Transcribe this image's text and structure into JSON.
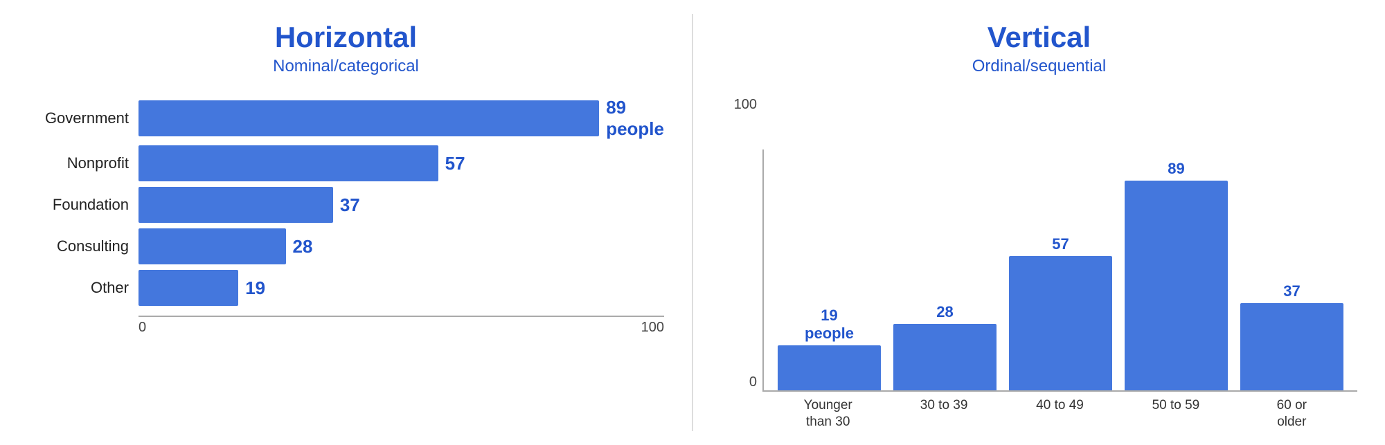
{
  "horizontal": {
    "title": "Horizontal",
    "subtitle": "Nominal/categorical",
    "bars": [
      {
        "label": "Government",
        "value": 89,
        "display": "89 people",
        "pct": 89
      },
      {
        "label": "Nonprofit",
        "value": 57,
        "display": "57",
        "pct": 57
      },
      {
        "label": "Foundation",
        "value": 37,
        "display": "37",
        "pct": 37
      },
      {
        "label": "Consulting",
        "value": 28,
        "display": "28",
        "pct": 28
      },
      {
        "label": "Other",
        "value": 19,
        "display": "19",
        "pct": 19
      }
    ],
    "axis": {
      "min": "0",
      "max": "100"
    }
  },
  "vertical": {
    "title": "Vertical",
    "subtitle": "Ordinal/sequential",
    "bars": [
      {
        "label": "Younger\nthan 30",
        "value": 19,
        "display": "19\npeople",
        "pct": 19
      },
      {
        "label": "30 to 39",
        "value": 28,
        "display": "28",
        "pct": 28
      },
      {
        "label": "40 to 49",
        "value": 57,
        "display": "57",
        "pct": 57
      },
      {
        "label": "50 to 59",
        "value": 89,
        "display": "89",
        "pct": 89
      },
      {
        "label": "60 or\nolder",
        "value": 37,
        "display": "37",
        "pct": 37
      }
    ],
    "yLabels": [
      "100",
      "0"
    ],
    "colors": {
      "bar": "#4477dd",
      "accent": "#2255cc"
    }
  }
}
